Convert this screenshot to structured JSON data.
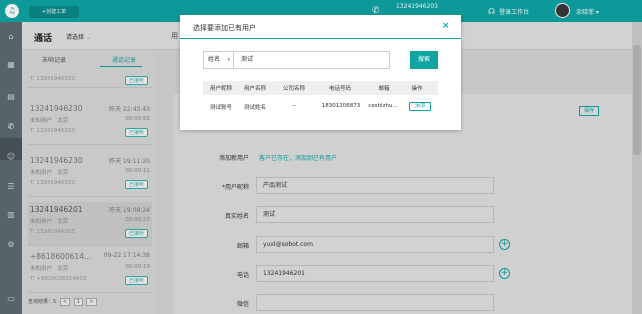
{
  "topbar": {
    "logo": "♫",
    "ticket_button": "+创建工单",
    "phone_number": "13241946203",
    "phone_status": "——",
    "online_status": "登录工作台",
    "username": "余晓菲"
  },
  "sidebar": {
    "icons": [
      "home-icon",
      "apps-icon",
      "docs-icon",
      "phone-icon",
      "user-icon",
      "list-icon",
      "chart-icon",
      "settings-icon",
      "chat-icon"
    ]
  },
  "call_panel": {
    "title": "通话",
    "filter": "请选择",
    "tabs": [
      "未响记录",
      "通话记录"
    ],
    "records": [
      {
        "phone": "13241946230",
        "time": "昨天 22:43:43",
        "loc": "未知用户",
        "region": "北京",
        "dur": "00:00:55",
        "sub": "T: 13241946203",
        "tag": "已接听"
      },
      {
        "phone": "13241946230",
        "time": "昨天 19:11:20",
        "loc": "未知用户",
        "region": "北京",
        "dur": "00:00:11",
        "sub": "T: 13241946203",
        "tag": "已接听"
      },
      {
        "phone": "13241946201",
        "time": "昨天 19:08:24",
        "loc": "未知用户",
        "region": "北京",
        "dur": "00:00:27",
        "sub": "T: 13241946203",
        "tag": "已接听"
      },
      {
        "phone": "+8618600614...",
        "time": "09-22 17:14:38",
        "loc": "未知用户",
        "region": "北京",
        "dur": "00:00:19",
        "sub": "T: +8620036314603",
        "tag": "已接听"
      }
    ],
    "top_record": {
      "sub": "T: 13241946203",
      "tag": "已接听"
    },
    "pager_text": "查询结果：5",
    "pager_prev": "<",
    "pager_page": "1",
    "pager_next": ">"
  },
  "main": {
    "tab_label": "用",
    "save_label": "保存",
    "add_user_label": "添加新用户",
    "add_user_hint": "客户已存在，添加到已有用户",
    "fields": [
      {
        "label": "*用户昵称",
        "value": "产品测试"
      },
      {
        "label": "真实姓名",
        "value": "测试"
      },
      {
        "label": "邮箱",
        "value": "yuxl@sobot.com"
      },
      {
        "label": "电话",
        "value": "13241946201"
      },
      {
        "label": "微信",
        "value": ""
      }
    ]
  },
  "modal": {
    "title": "选择要添加已有用户",
    "close": "×",
    "search_field": "姓名",
    "search_value": "测试",
    "search_button": "搜索",
    "columns": [
      "用户昵称",
      "用户名称",
      "公司名称",
      "电话号码",
      "邮箱",
      "操作"
    ],
    "rows": [
      {
        "nickname": "测试账号",
        "name": "测试姓名",
        "company": "--",
        "phone": "18301206873",
        "email": "ceshizhu...",
        "action": "添加"
      }
    ]
  },
  "colors": {
    "accent": "#0fa5a5",
    "sidebar": "#5d6b73"
  }
}
